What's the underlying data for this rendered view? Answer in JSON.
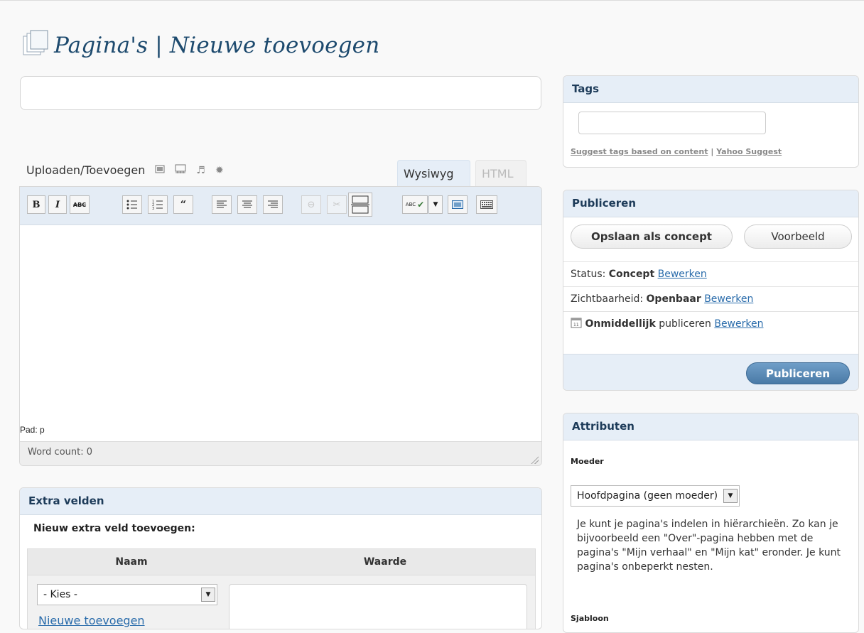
{
  "page": {
    "title": "Pagina's | Nieuwe toevoegen"
  },
  "editor": {
    "media_label": "Uploaden/Toevoegen",
    "tab_visual": "Wysiwyg",
    "tab_html": "HTML",
    "toolbar": {
      "bold": "B",
      "italic": "I",
      "strike": "ABC",
      "spell": "ABC"
    },
    "path": "Pad: p",
    "word_count": "Word count: 0"
  },
  "extra_fields": {
    "title": "Extra velden",
    "subtitle": "Nieuw extra veld toevoegen:",
    "col_name": "Naam",
    "col_value": "Waarde",
    "select_value": "- Kies -",
    "new_link": "Nieuwe toevoegen"
  },
  "tags": {
    "title": "Tags",
    "input_value": "",
    "suggest_link": "Suggest tags based on content",
    "separator": "|",
    "yahoo_link": "Yahoo Suggest"
  },
  "publish": {
    "title": "Publiceren",
    "save_draft": "Opslaan als concept",
    "preview": "Voorbeeld",
    "status_label": "Status:",
    "status_value": "Concept",
    "visibility_label": "Zichtbaarheid:",
    "visibility_value": "Openbaar",
    "schedule_value": "Onmiddellijk",
    "schedule_suffix": "publiceren",
    "edit_link": "Bewerken",
    "publish_button": "Publiceren"
  },
  "attributes": {
    "title": "Attributen",
    "parent_label": "Moeder",
    "parent_value": "Hoofdpagina (geen moeder)",
    "description": "Je kunt je pagina's indelen in hiërarchieën. Zo kan je bijvoorbeeld een \"Over\"-pagina hebben met de pagina's \"Mijn verhaal\" en \"Mijn kat\" eronder. Je kunt pagina's onbeperkt nesten.",
    "template_label": "Sjabloon"
  },
  "colors": {
    "accent": "#1d4a6e",
    "header_bg": "#e6eef7",
    "link": "#2a6cab",
    "publish_btn": "#5a8ab6"
  }
}
